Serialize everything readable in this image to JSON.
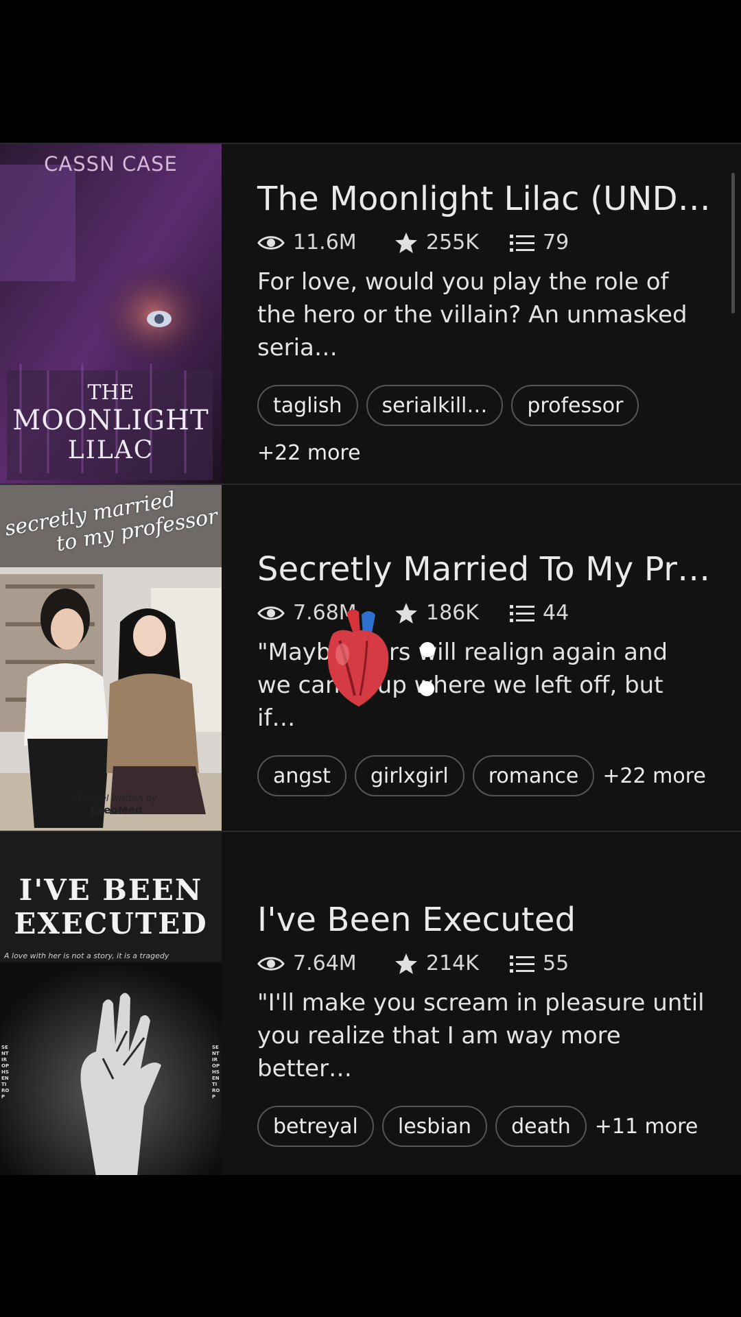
{
  "stories": [
    {
      "title": "The Moonlight Lilac (UND…",
      "views": "11.6M",
      "votes": "255K",
      "parts": "79",
      "description": "For love, would you play the role of the hero or the villain? An unmasked seria…",
      "tags": [
        "taglish",
        "serialkill…",
        "professor"
      ],
      "more": "+22 more",
      "cover": {
        "author": "CASSN CASE",
        "line1": "THE",
        "line2": "MOONLIGHT",
        "line3": "LILAC",
        "accent": "#8a3fb5"
      }
    },
    {
      "title": "Secretly Married To My Pr…",
      "views": "7.68M",
      "votes": "186K",
      "parts": "44",
      "description": "\"Mayb   stars will realign again and we can     up where we left off, but if…",
      "tags": [
        "angst",
        "girlxgirl",
        "romance"
      ],
      "more": "+22 more",
      "cover": {
        "script1": "secretly married",
        "script2": "to my professor",
        "credit1": "A novel written by",
        "credit2": "EyeoMed",
        "accent": "#8d7258"
      }
    },
    {
      "title": "I've Been Executed",
      "views": "7.64M",
      "votes": "214K",
      "parts": "55",
      "description": "\"I'll make you scream in pleasure until you realize that I am way more better…",
      "tags": [
        "betreyal",
        "lesbian",
        "death"
      ],
      "more": "+11 more",
      "cover": {
        "line1": "I'VE BEEN",
        "line2": "EXECUTED",
        "tagline": "A love with her is not a story, it is a tragedy",
        "side": "SENTIROPHSENTIROP"
      }
    }
  ],
  "icons": {
    "views": "eye-icon",
    "votes": "star-icon",
    "parts": "list-icon"
  },
  "colors": {
    "background": "#121212",
    "text": "#e9e9e9",
    "tag_border": "#555555"
  }
}
